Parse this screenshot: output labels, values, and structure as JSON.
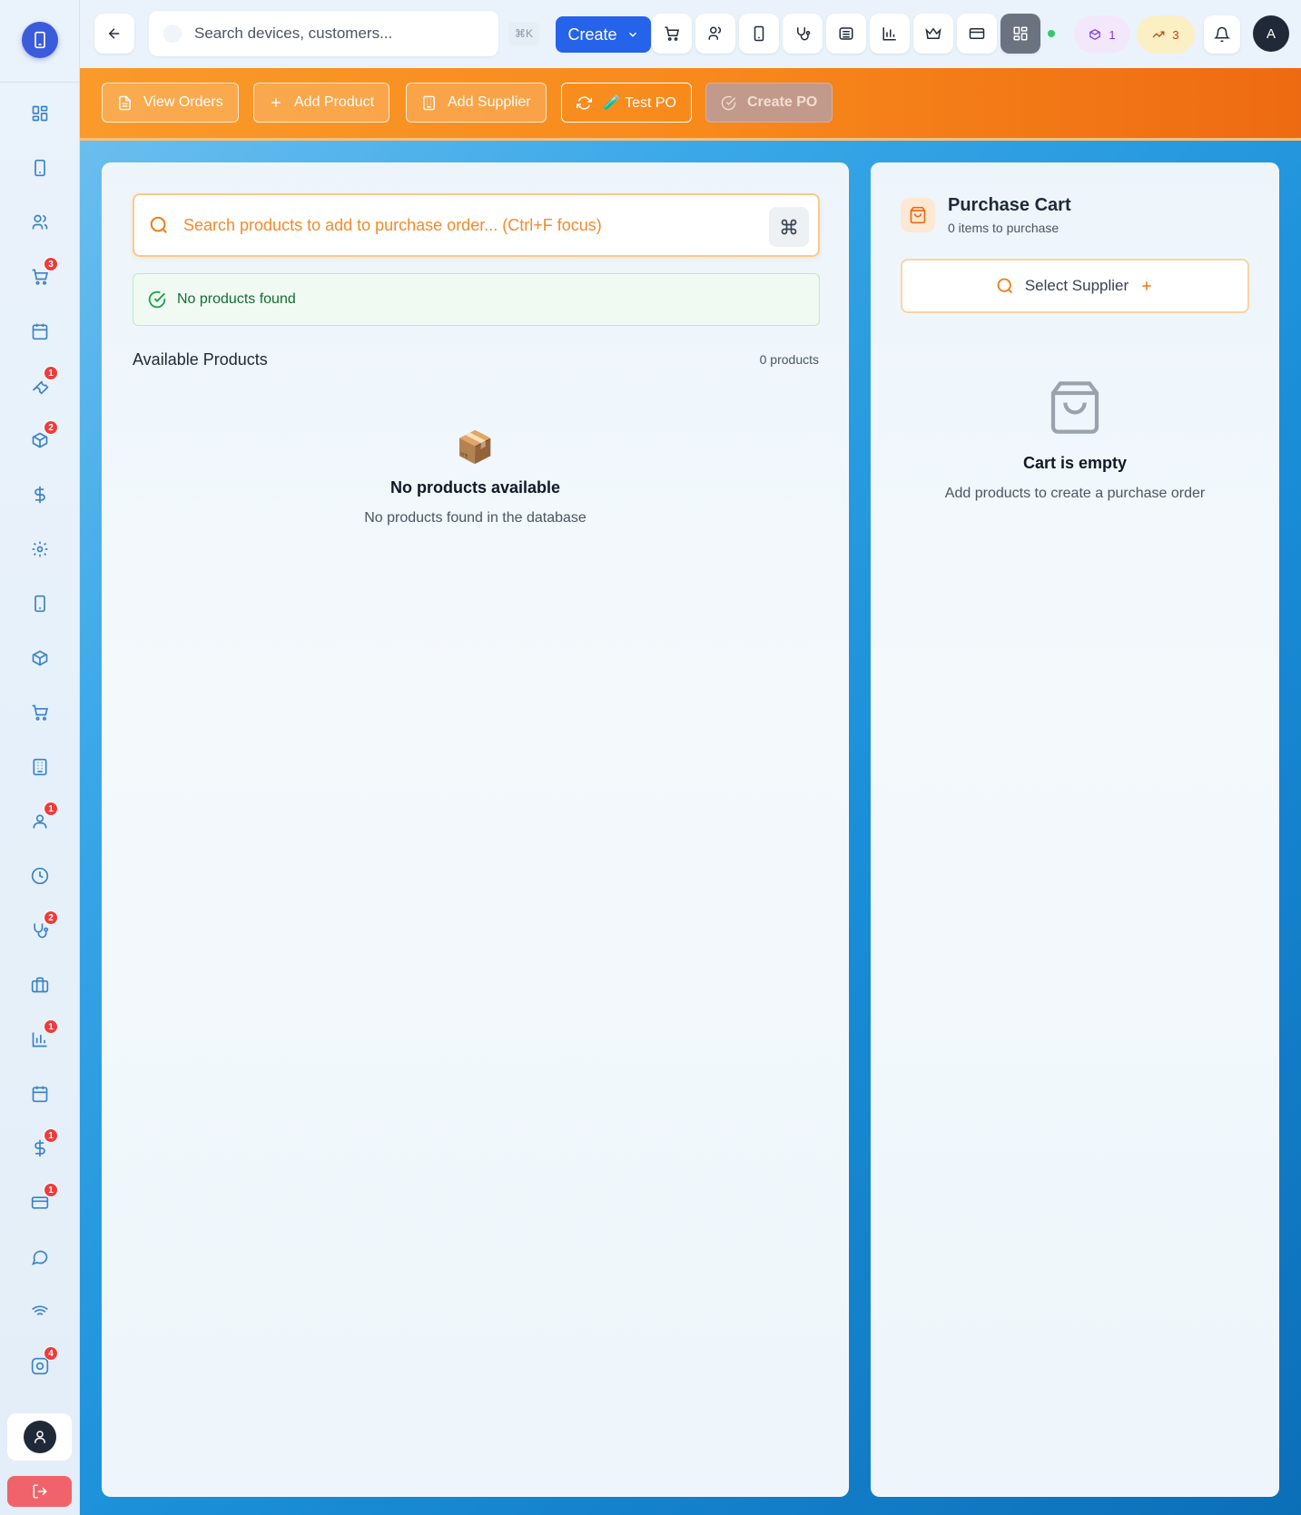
{
  "topbar": {
    "search_placeholder": "Search devices, customers...",
    "shortcut": "⌘K",
    "create_label": "Create",
    "pill_products_count": "1",
    "pill_trending_count": "3",
    "avatar_initial": "A"
  },
  "actions": {
    "view_orders": "View Orders",
    "add_product": "Add Product",
    "add_supplier": "Add Supplier",
    "test_po": "🧪 Test PO",
    "create_po": "Create PO"
  },
  "products": {
    "search_placeholder": "Search products to add to purchase order... (Ctrl+F focus)",
    "status_message": "No products found",
    "section_title": "Available Products",
    "count_label": "0 products",
    "empty_emoji": "📦",
    "empty_title": "No products available",
    "empty_subtitle": "No products found in the database"
  },
  "cart": {
    "title": "Purchase Cart",
    "subtitle": "0 items to purchase",
    "select_supplier": "Select Supplier",
    "empty_title": "Cart is empty",
    "empty_subtitle": "Add products to create a purchase order"
  },
  "sidebar": {
    "badges": {
      "orders": "3",
      "repairs": "1",
      "inventory": "2",
      "customers": "1",
      "diagnostics": "2",
      "reports": "1",
      "payments": "1",
      "finance": "1",
      "instagram": "4"
    }
  },
  "colors": {
    "primary": "#2563eb",
    "accent_orange": "#f88a1c",
    "badge_red": "#ef3b3b",
    "success_green": "#146c33"
  }
}
